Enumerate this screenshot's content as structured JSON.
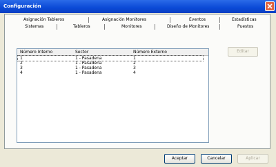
{
  "window": {
    "title": "Configuración"
  },
  "tabs_row1": [
    "Asignación Tableros",
    "Asignación Monitores",
    "Eventos",
    "Estadísticas"
  ],
  "tabs_row2": [
    "Sistemas",
    "Tableros",
    "Monitores",
    "Diseño de Monitores",
    "Puestos"
  ],
  "active_tab": "Puestos",
  "list": {
    "columns": [
      "Número Interno",
      "Sector",
      "Número Externo"
    ],
    "rows": [
      [
        "1",
        "1 - Pasadena",
        "1"
      ],
      [
        "2",
        "1 - Pasadena",
        "2"
      ],
      [
        "3",
        "1 - Pasadena",
        "3"
      ],
      [
        "4",
        "1 - Pasadena",
        "4"
      ]
    ]
  },
  "buttons": {
    "side": "Editar",
    "accept": "Aceptar",
    "cancel": "Cancelar",
    "apply": "Aplicar"
  }
}
